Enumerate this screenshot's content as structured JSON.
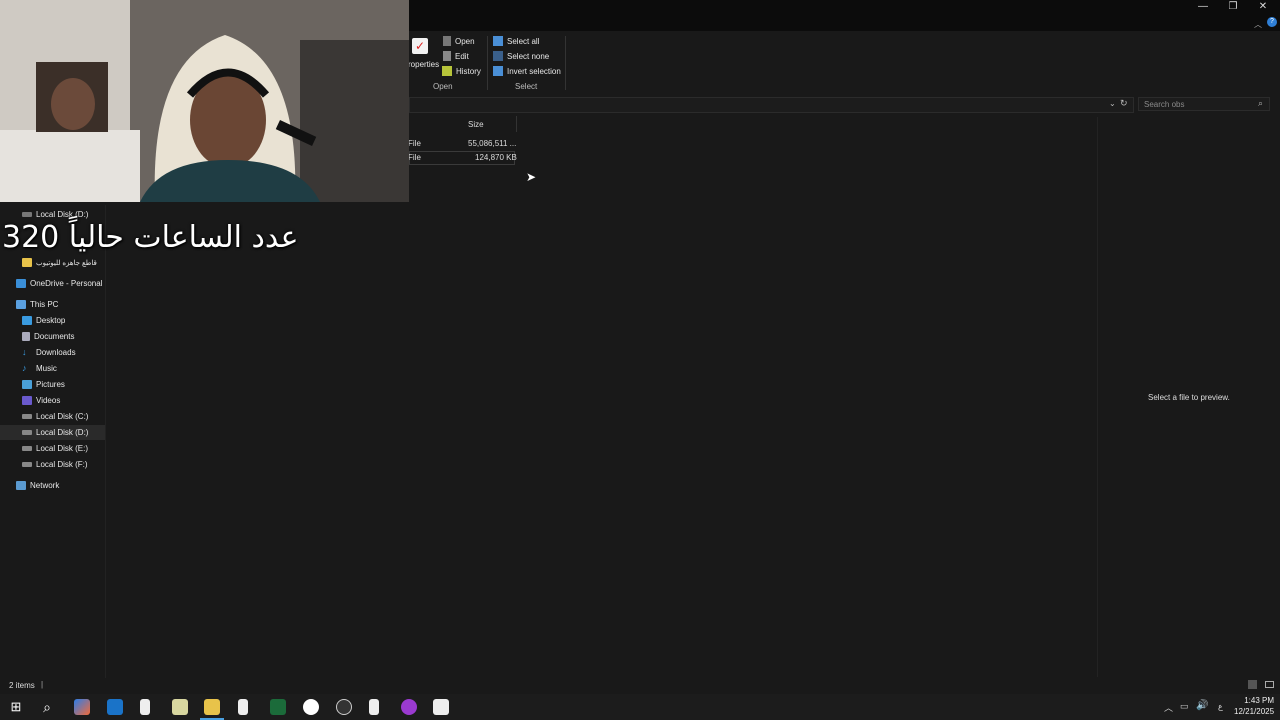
{
  "window": {
    "minimize": "—",
    "maximize": "❐",
    "close": "✕"
  },
  "ribbon": {
    "properties_label": "roperties",
    "open_label": "Open",
    "edit_label": "Edit",
    "history_label": "History",
    "open_group": "Open",
    "select_all": "Select all",
    "select_none": "Select none",
    "invert_selection": "Invert selection",
    "select_group": "Select"
  },
  "search": {
    "placeholder": "Search obs"
  },
  "columns": {
    "size": "Size"
  },
  "files": [
    {
      "type": "File",
      "size": "55,086,511 ..."
    },
    {
      "type": "File",
      "size": "124,870 KB"
    }
  ],
  "preview": {
    "text": "Select a file to preview."
  },
  "nav": {
    "partial_top": "Local Disk (D:)",
    "partial_folder": "قاطع جاهزه لليوتيوب",
    "onedrive": "OneDrive - Personal",
    "thispc": "This PC",
    "desktop": "Desktop",
    "documents": "Documents",
    "downloads": "Downloads",
    "music": "Music",
    "pictures": "Pictures",
    "videos": "Videos",
    "disk_c": "Local Disk (C:)",
    "disk_d": "Local Disk (D:)",
    "disk_e": "Local Disk (E:)",
    "disk_f": "Local Disk (F:)",
    "network": "Network"
  },
  "overlay": {
    "text": "عدد الساعات حالياً 320"
  },
  "status": {
    "items": "2 items"
  },
  "tray": {
    "time": "1:43 PM",
    "date": "12/21/2025",
    "lang": "ع"
  }
}
